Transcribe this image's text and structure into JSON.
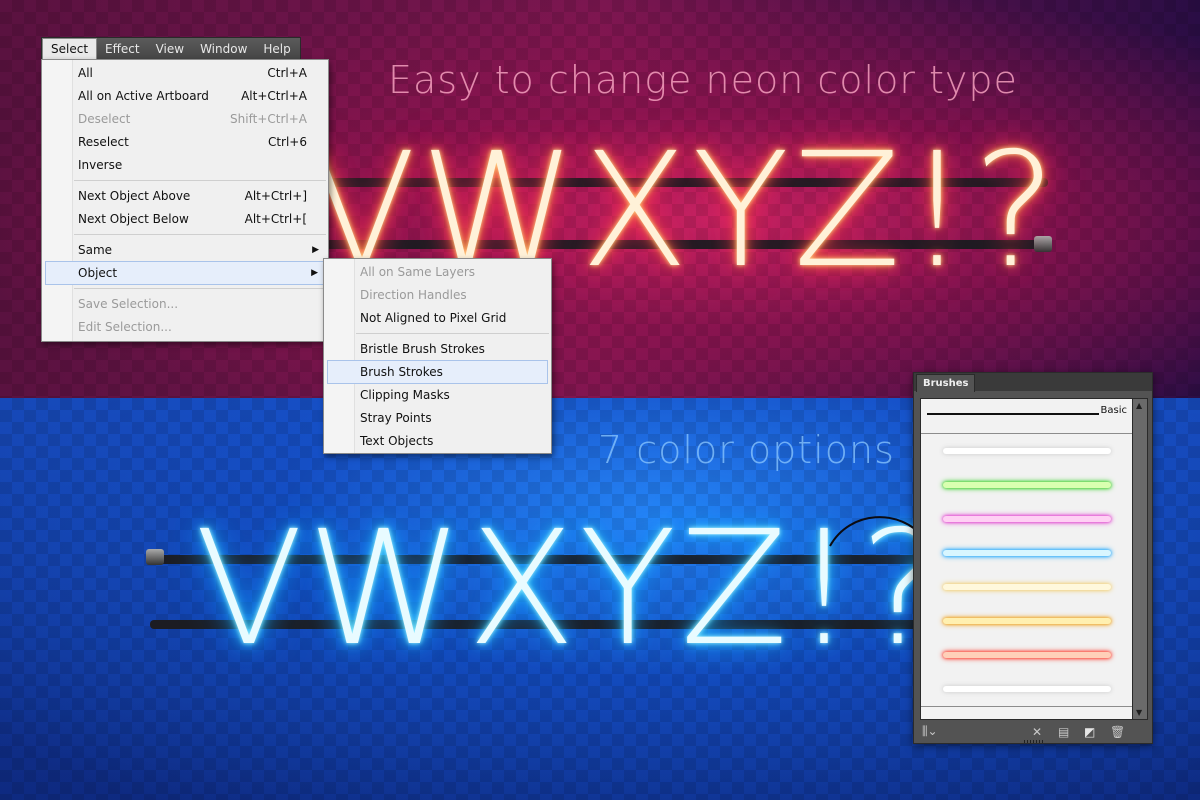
{
  "headlines": {
    "top": "Easy to change neon color type",
    "bottom": "7 color options"
  },
  "neon_text": {
    "red": "VWXYZ!?",
    "blue": "VWXYZ!?"
  },
  "menubar": {
    "items": [
      "Select",
      "Effect",
      "View",
      "Window",
      "Help"
    ],
    "active": "Select"
  },
  "select_menu": {
    "items": [
      {
        "label": "All",
        "shortcut": "Ctrl+A",
        "disabled": false
      },
      {
        "label": "All on Active Artboard",
        "shortcut": "Alt+Ctrl+A",
        "disabled": false
      },
      {
        "label": "Deselect",
        "shortcut": "Shift+Ctrl+A",
        "disabled": true
      },
      {
        "label": "Reselect",
        "shortcut": "Ctrl+6",
        "disabled": false
      },
      {
        "label": "Inverse",
        "shortcut": "",
        "disabled": false
      },
      {
        "label": "Next Object Above",
        "shortcut": "Alt+Ctrl+]",
        "disabled": false
      },
      {
        "label": "Next Object Below",
        "shortcut": "Alt+Ctrl+[",
        "disabled": false
      },
      {
        "label": "Same",
        "shortcut": "",
        "disabled": false,
        "submenu": true
      },
      {
        "label": "Object",
        "shortcut": "",
        "disabled": false,
        "submenu": true,
        "highlighted": true
      },
      {
        "label": "Save Selection...",
        "shortcut": "",
        "disabled": true
      },
      {
        "label": "Edit Selection...",
        "shortcut": "",
        "disabled": true
      }
    ]
  },
  "object_submenu": {
    "items": [
      {
        "label": "All on Same Layers",
        "disabled": true
      },
      {
        "label": "Direction Handles",
        "disabled": true
      },
      {
        "label": "Not Aligned to Pixel Grid",
        "disabled": false
      },
      {
        "label": "Bristle Brush Strokes",
        "disabled": false
      },
      {
        "label": "Brush Strokes",
        "disabled": false,
        "highlighted": true
      },
      {
        "label": "Clipping Masks",
        "disabled": false
      },
      {
        "label": "Stray Points",
        "disabled": false
      },
      {
        "label": "Text Objects",
        "disabled": false
      }
    ]
  },
  "brushes_panel": {
    "tab": "Brushes",
    "basic_label": "Basic",
    "swatches": [
      {
        "name": "white",
        "color": "#ffffff",
        "glow": "#d8d8d8"
      },
      {
        "name": "green",
        "color": "#d9ffb0",
        "glow": "#3bd12a"
      },
      {
        "name": "pink",
        "color": "#ffd0f4",
        "glow": "#e23ad0"
      },
      {
        "name": "blue",
        "color": "#d8f6ff",
        "glow": "#1ea8ff"
      },
      {
        "name": "pale-yellow",
        "color": "#fff8dc",
        "glow": "#f3d27a"
      },
      {
        "name": "orange",
        "color": "#fff0b0",
        "glow": "#f0a21a"
      },
      {
        "name": "red",
        "color": "#ffd0b8",
        "glow": "#ff3b2a"
      },
      {
        "name": "white-2",
        "color": "#ffffff",
        "glow": "#d8d8d8"
      }
    ],
    "footer_icons": [
      "brush-libraries-icon",
      "remove-stroke-icon",
      "brush-options-icon",
      "new-brush-icon",
      "delete-brush-icon"
    ]
  },
  "colors": {
    "menu_highlight": "#e6eefb",
    "panel_bg": "#535353"
  }
}
